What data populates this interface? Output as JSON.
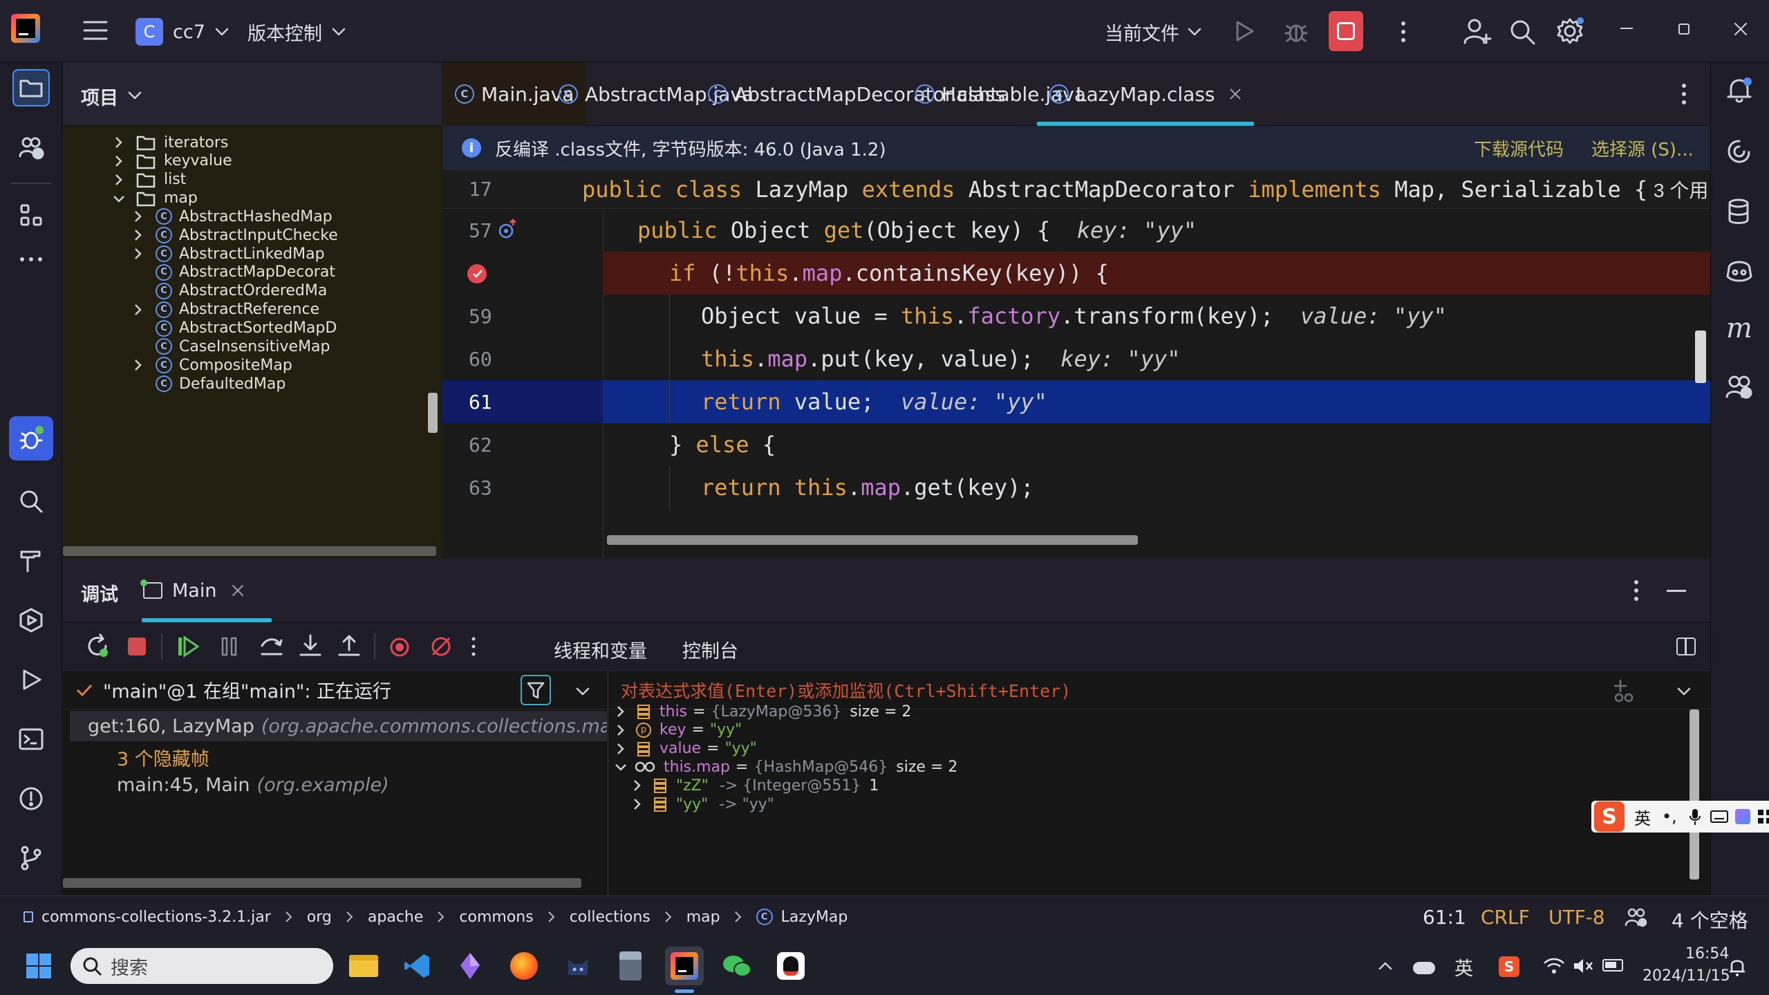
{
  "titlebar": {
    "project_badge": "C",
    "project_name": "cc7",
    "vcs_label": "版本控制",
    "run_config": "当前文件"
  },
  "project_panel": {
    "title": "项目",
    "items": [
      {
        "label": "iterators",
        "kind": "folder",
        "expanded": false
      },
      {
        "label": "keyvalue",
        "kind": "folder",
        "expanded": false
      },
      {
        "label": "list",
        "kind": "folder",
        "expanded": false
      },
      {
        "label": "map",
        "kind": "folder",
        "expanded": true
      },
      {
        "label": "AbstractHashedMap",
        "kind": "class",
        "arrow": true
      },
      {
        "label": "AbstractInputChecke",
        "kind": "class",
        "arrow": true
      },
      {
        "label": "AbstractLinkedMap",
        "kind": "class",
        "arrow": true
      },
      {
        "label": "AbstractMapDecorat",
        "kind": "class",
        "arrow": false
      },
      {
        "label": "AbstractOrderedMa",
        "kind": "class",
        "arrow": false
      },
      {
        "label": "AbstractReference",
        "kind": "class",
        "arrow": true
      },
      {
        "label": "AbstractSortedMapD",
        "kind": "class",
        "arrow": false
      },
      {
        "label": "CaseInsensitiveMap",
        "kind": "class",
        "arrow": false
      },
      {
        "label": "CompositeMap",
        "kind": "class",
        "arrow": true
      },
      {
        "label": "DefaultedMap",
        "kind": "class",
        "arrow": false
      }
    ]
  },
  "editor": {
    "tabs": [
      {
        "label": "Main.java",
        "active": false
      },
      {
        "label": "AbstractMap.java",
        "active": false
      },
      {
        "label": "AbstractMapDecorator.class",
        "active": false
      },
      {
        "label": "Hashtable.java",
        "active": false
      },
      {
        "label": "LazyMap.class",
        "active": true
      }
    ],
    "info_text": "反编译 .class文件, 字节码版本: 46.0 (Java 1.2)",
    "info_link_download": "下载源代码",
    "info_link_choose": "选择源 (S)...",
    "sticky": {
      "line": "17",
      "usages": "3 个用"
    },
    "lines": [
      {
        "num": "57"
      },
      {
        "num": ""
      },
      {
        "num": "59"
      },
      {
        "num": "60"
      },
      {
        "num": "61"
      },
      {
        "num": "62"
      },
      {
        "num": "63"
      }
    ],
    "hints": {
      "h57": "key: \"yy\"",
      "h59": "value: \"yy\"",
      "h60": "key: \"yy\"",
      "h61": "value: \"yy\""
    }
  },
  "debug": {
    "title": "调试",
    "session_tab": "Main",
    "subtabs": [
      "线程和变量",
      "控制台"
    ],
    "thread_status": "\"main\"@1 在组\"main\": 正在运行",
    "frames": [
      {
        "label": "get:160, LazyMap",
        "pkg": "(org.apache.commons.collections.map)"
      },
      {
        "label": "3 个隐藏帧",
        "pkg": ""
      },
      {
        "label": "main:45, Main",
        "pkg": "(org.example)"
      }
    ],
    "eval_placeholder": "对表达式求值(Enter)或添加监视(Ctrl+Shift+Enter)",
    "variables": [
      {
        "name": "this",
        "value": "{LazyMap@536}",
        "extra": "size = 2"
      },
      {
        "name": "key",
        "value": "\"yy\"",
        "extra": ""
      },
      {
        "name": "value",
        "value": "\"yy\"",
        "extra": ""
      },
      {
        "name": "this.map",
        "value": "{HashMap@546}",
        "extra": "size = 2"
      },
      {
        "name": "\"zZ\"",
        "value": "-> {Integer@551}",
        "extra": "1"
      },
      {
        "name": "\"yy\"",
        "value": "-> \"yy\"",
        "extra": ""
      }
    ],
    "ime_label": "英"
  },
  "statusbar": {
    "breadcrumb": [
      "commons-collections-3.2.1.jar",
      "org",
      "apache",
      "commons",
      "collections",
      "map",
      "LazyMap"
    ],
    "position": "61:1",
    "line_sep": "CRLF",
    "encoding": "UTF-8",
    "indent": "4 个空格"
  },
  "taskbar": {
    "search_placeholder": "搜索",
    "lang": "英",
    "time": "16:54",
    "date": "2024/11/15"
  },
  "colors": {
    "accent": "#548af7",
    "breakpoint_line": "#4a1712",
    "exec_line": "#0d2a88",
    "keyword": "#e3a33c",
    "field": "#c77dd6",
    "string": "#77b84d",
    "tab_underline": "#2fb5d2"
  }
}
